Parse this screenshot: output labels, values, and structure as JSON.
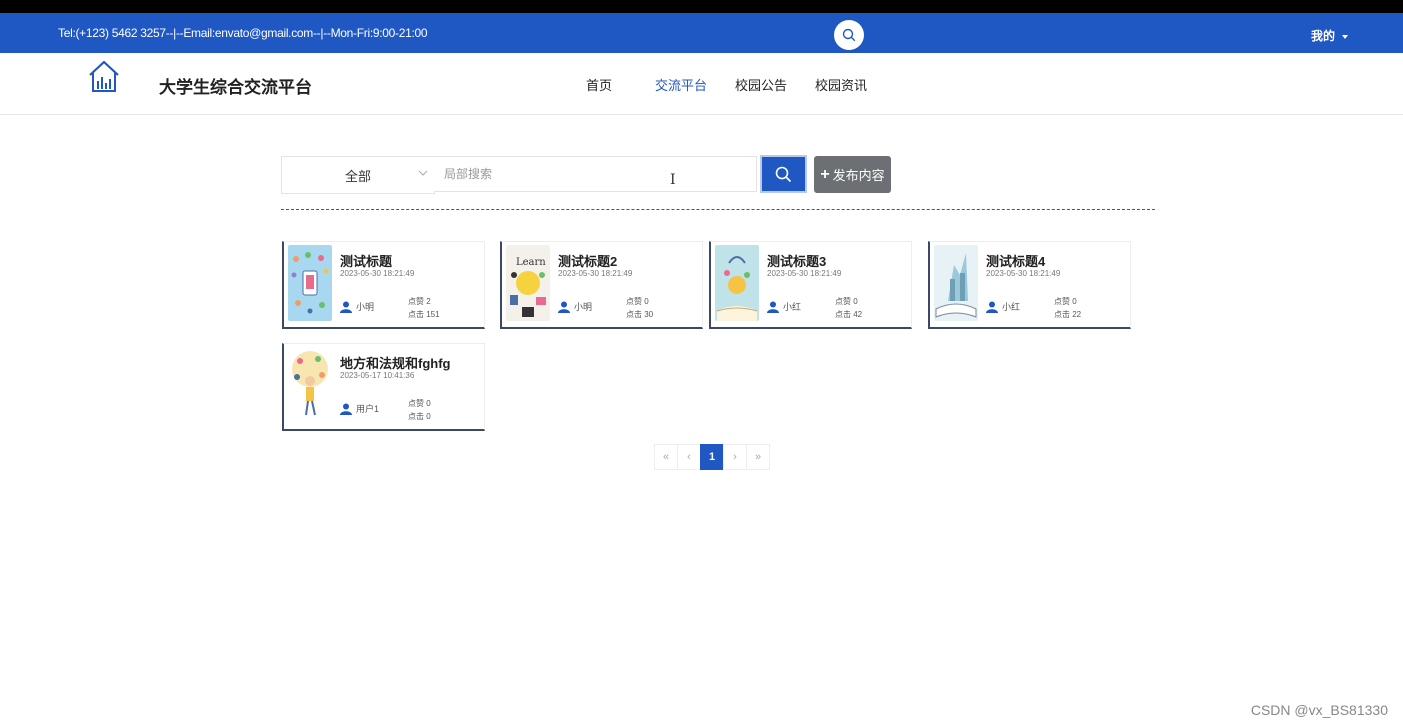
{
  "topbar": {
    "contact": "Tel:(+123) 5462 3257--|--Email:envato@gmail.com--|--Mon-Fri:9:00-21:00",
    "user_menu": "我的",
    "search_icon": "search-icon"
  },
  "header": {
    "site_title": "大学生综合交流平台",
    "logo_icon": "house-chart-icon",
    "nav": [
      {
        "label": "首页",
        "active": false
      },
      {
        "label": "交流平台",
        "active": true
      },
      {
        "label": "校园公告",
        "active": false
      },
      {
        "label": "校园资讯",
        "active": false
      }
    ]
  },
  "filter": {
    "category_selected": "全部",
    "search_placeholder": "局部搜索",
    "search_value": "",
    "publish_label": "发布内容"
  },
  "posts": [
    {
      "title": "测试标题",
      "date": "2023-05-30 18:21:49",
      "author": "小明",
      "likes": "点赞 2",
      "clicks": "点击 151"
    },
    {
      "title": "测试标题2",
      "date": "2023-05-30 18:21:49",
      "author": "小明",
      "likes": "点赞 0",
      "clicks": "点击 30"
    },
    {
      "title": "测试标题3",
      "date": "2023-05-30 18:21:49",
      "author": "小红",
      "likes": "点赞 0",
      "clicks": "点击 42"
    },
    {
      "title": "测试标题4",
      "date": "2023-05-30 18:21:49",
      "author": "小红",
      "likes": "点赞 0",
      "clicks": "点击 22"
    },
    {
      "title": "地方和法规和fghfg",
      "date": "2023-05-17 10:41:36",
      "author": "用户1",
      "likes": "点赞 0",
      "clicks": "点击 0"
    }
  ],
  "pagination": {
    "first": "«",
    "prev": "‹",
    "current": "1",
    "next": "›",
    "last": "»"
  },
  "watermark": "CSDN @vx_BS81330",
  "colors": {
    "primary": "#1f57c3",
    "publish": "#6c6f73",
    "card_border": "#3a4a66"
  }
}
